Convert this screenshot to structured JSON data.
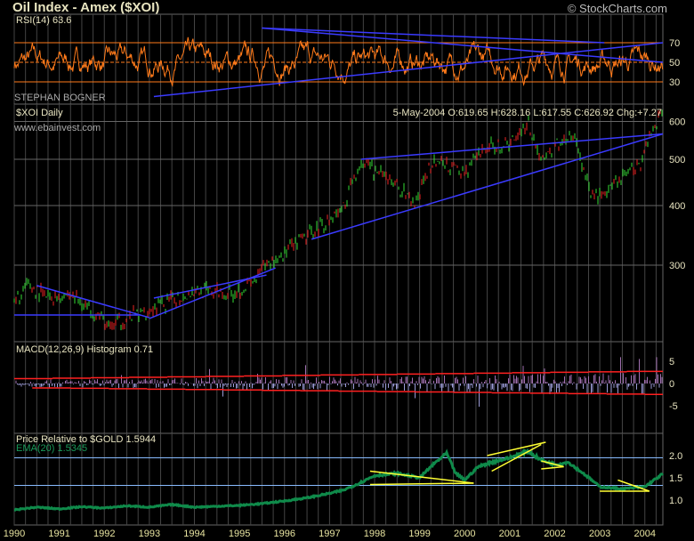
{
  "header": {
    "title": "Oil Index - Amex ($XOI)",
    "copyright": "© StockCharts.com"
  },
  "rsi": {
    "label": "RSI(14) 63.6",
    "levels": [
      70,
      50,
      30
    ],
    "watermark": "STEPHAN BOGNER"
  },
  "price": {
    "label": "$XOI Daily",
    "quote": "5-May-2004 O:619.65 H:628.16 L:617.55 C:626.92 Chg:+7.27",
    "website": "www.ebainvest.com",
    "ticks": [
      300,
      400,
      500,
      600
    ]
  },
  "macd": {
    "label": "MACD(12,26,9) Histogram  0.71",
    "ticks": [
      5,
      0,
      -5
    ]
  },
  "relative": {
    "label": "Price Relative to $GOLD  1.5944",
    "ema_label": "EMA(20) 1.5345",
    "ticks": [
      "2.0",
      "1.5",
      "1.0"
    ]
  },
  "colors": {
    "rsi": "#ff7a1a",
    "trend": "#3a3aff",
    "up": "#33dd33",
    "down": "#ee2222",
    "macd_pos": "#a070b0",
    "macd_neg": "#9c9cd8",
    "band": "#ff2020",
    "relative": "#0f8a4a",
    "rel_trend": "#ffff33",
    "ref": "#88bbff"
  },
  "chart_data": {
    "type": "line",
    "title": "Oil Index - Amex ($XOI)",
    "x_ticks": [
      "1990",
      "1991",
      "1992",
      "1993",
      "1994",
      "1995",
      "1996",
      "1997",
      "1998",
      "1999",
      "2000",
      "2001",
      "2002",
      "2003",
      "2004"
    ],
    "xlim": [
      1990,
      2004.4
    ],
    "price_series": {
      "name": "$XOI Daily",
      "scale": "log",
      "ylim": [
        208,
        662
      ],
      "x": [
        1990,
        1990.3,
        1990.8,
        1991.2,
        1991.8,
        1992.1,
        1992.8,
        1993.3,
        1994,
        1994.8,
        1995.3,
        1995.6,
        1996,
        1996.5,
        1997,
        1997.3,
        1997.7,
        1998,
        1998.5,
        1998.9,
        1999.3,
        1999.7,
        2000,
        2000.5,
        2001,
        2001.4,
        2001.7,
        2002,
        2002.4,
        2002.8,
        2003.2,
        2003.6,
        2003.9,
        2004.1,
        2004.35
      ],
      "y": [
        248,
        272,
        255,
        262,
        240,
        222,
        238,
        248,
        265,
        262,
        275,
        300,
        318,
        345,
        375,
        395,
        495,
        470,
        440,
        400,
        500,
        480,
        470,
        530,
        540,
        600,
        495,
        530,
        565,
        420,
        425,
        470,
        490,
        560,
        627
      ]
    },
    "rsi_series": {
      "name": "RSI(14)",
      "ylim": [
        0,
        100
      ],
      "last": 63.6
    },
    "macd_histogram": {
      "name": "MACD(12,26,9) Histogram",
      "ylim": [
        -10,
        10
      ],
      "last": 0.71
    },
    "relative_series": {
      "name": "Price Relative to $GOLD",
      "ylim": [
        0.5,
        2.4
      ],
      "x": [
        1990,
        1990.5,
        1991,
        1991.5,
        1992,
        1992.5,
        1993,
        1993.5,
        1994,
        1994.5,
        1995,
        1995.5,
        1996,
        1996.5,
        1997,
        1997.3,
        1997.6,
        1998,
        1998.5,
        1999,
        1999.3,
        1999.6,
        1999.8,
        2000,
        2000.3,
        2000.6,
        2001,
        2001.4,
        2001.7,
        2002,
        2002.3,
        2002.7,
        2003,
        2003.5,
        2004,
        2004.4
      ],
      "y": [
        0.78,
        0.84,
        0.8,
        0.85,
        0.82,
        0.87,
        0.84,
        0.9,
        0.84,
        0.86,
        0.88,
        0.92,
        0.98,
        1.05,
        1.15,
        1.22,
        1.35,
        1.55,
        1.6,
        1.5,
        1.8,
        2.05,
        1.6,
        1.45,
        1.75,
        1.85,
        1.95,
        2.1,
        1.9,
        1.8,
        1.85,
        1.55,
        1.3,
        1.25,
        1.3,
        1.59
      ],
      "last": 1.5944,
      "ema20": 1.5345,
      "reference_lines": [
        1.95,
        1.33
      ]
    }
  }
}
